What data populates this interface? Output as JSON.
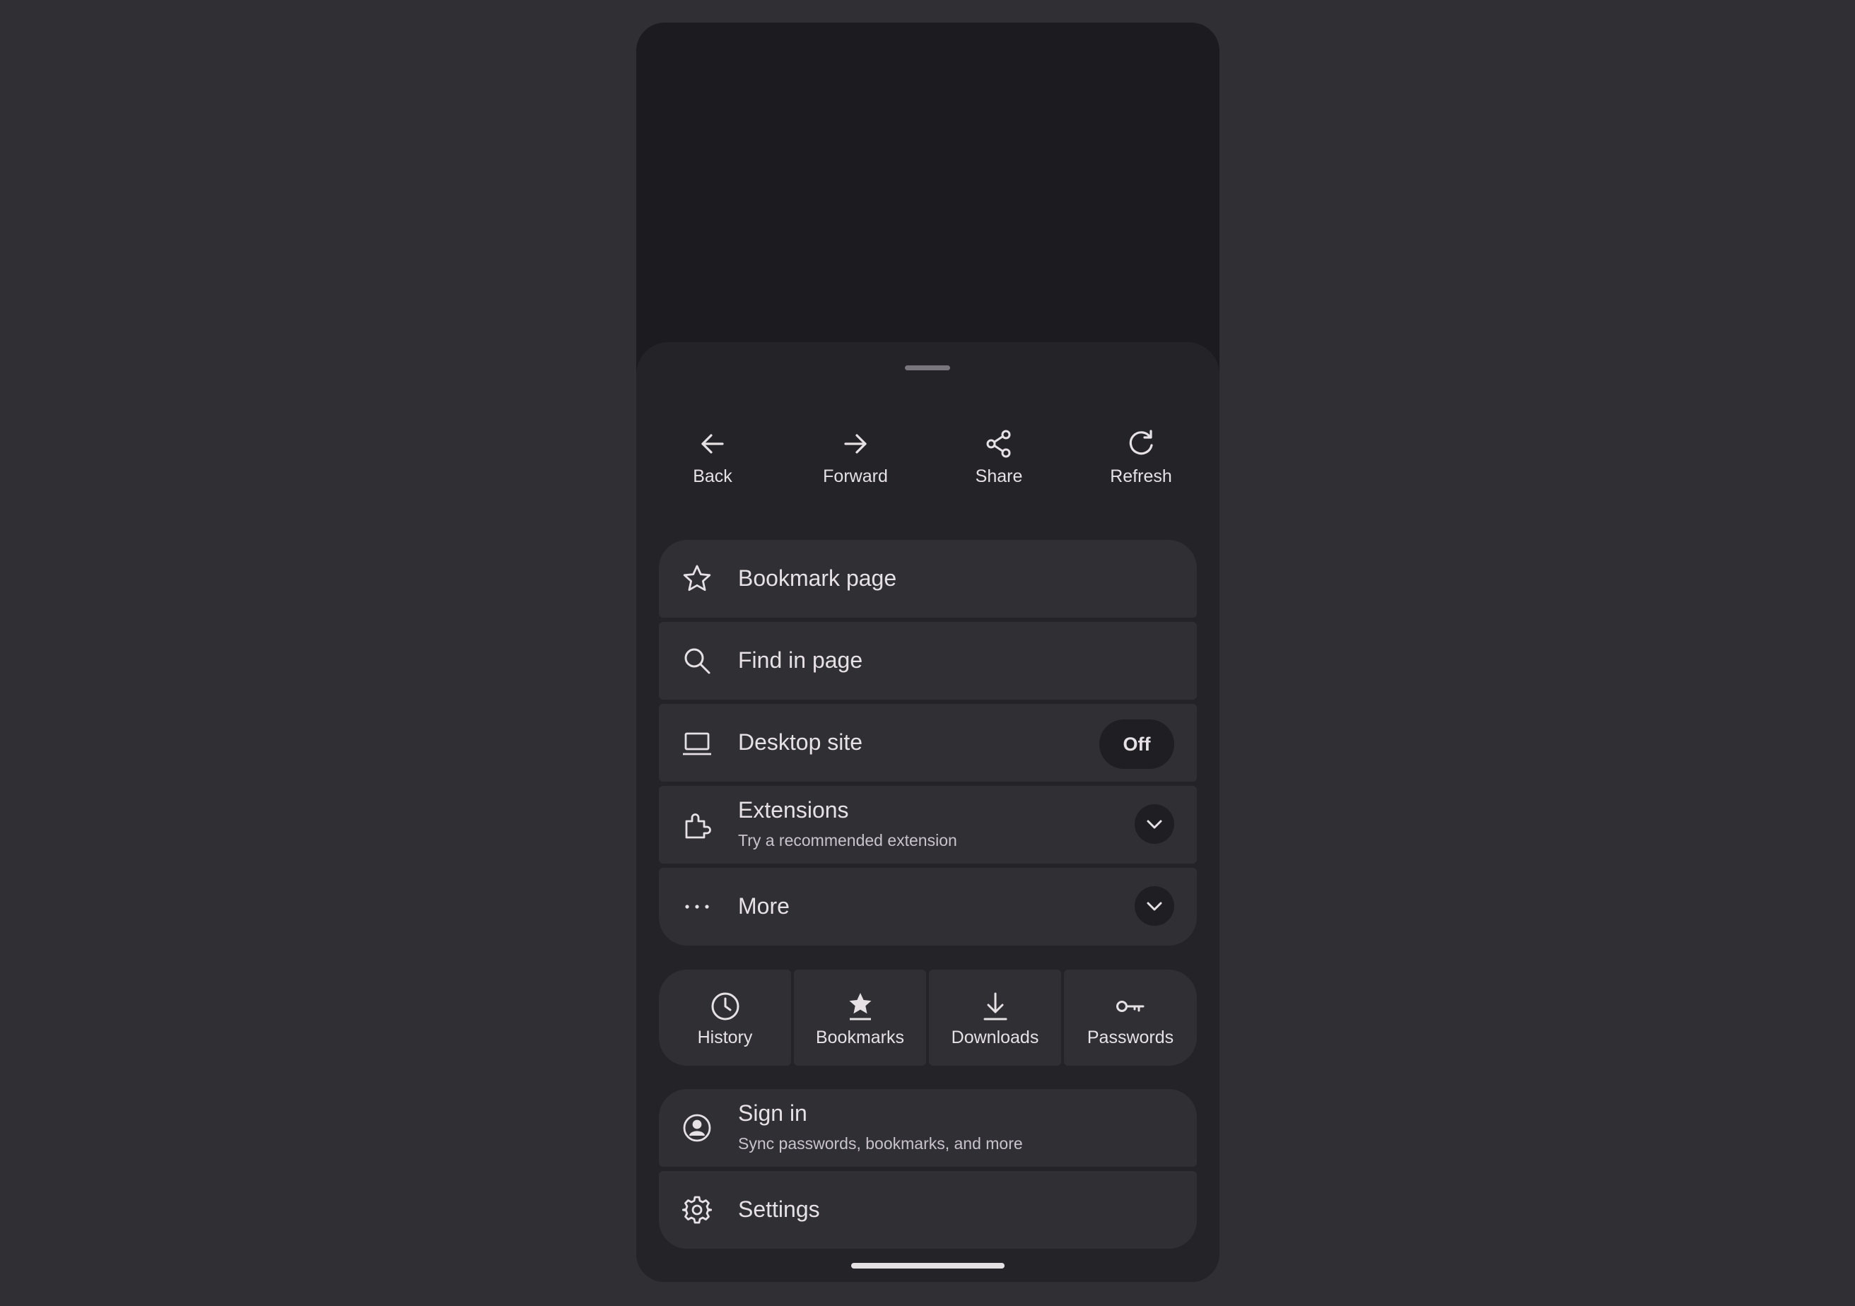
{
  "colors": {
    "backdrop": "#302f33",
    "screen": "#1c1b1f",
    "sheet": "#242328",
    "card": "#302f34",
    "pill": "#1f1e22",
    "text": "#e6e1e5",
    "subtext": "#c9c4cc"
  },
  "toolbar": {
    "back": {
      "label": "Back",
      "icon": "arrow-left-icon"
    },
    "forward": {
      "label": "Forward",
      "icon": "arrow-right-icon"
    },
    "share": {
      "label": "Share",
      "icon": "share-icon"
    },
    "refresh": {
      "label": "Refresh",
      "icon": "refresh-icon"
    }
  },
  "menu": {
    "bookmark_page": {
      "label": "Bookmark page",
      "icon": "star-outline-icon"
    },
    "find_in_page": {
      "label": "Find in page",
      "icon": "search-icon"
    },
    "desktop_site": {
      "label": "Desktop site",
      "icon": "laptop-icon",
      "state": "Off"
    },
    "extensions": {
      "label": "Extensions",
      "subtitle": "Try a recommended extension",
      "icon": "puzzle-icon"
    },
    "more": {
      "label": "More",
      "icon": "more-horizontal-icon"
    }
  },
  "shortcuts": {
    "history": {
      "label": "History",
      "icon": "clock-icon"
    },
    "bookmarks": {
      "label": "Bookmarks",
      "icon": "bookmark-star-icon"
    },
    "downloads": {
      "label": "Downloads",
      "icon": "download-icon"
    },
    "passwords": {
      "label": "Passwords",
      "icon": "key-icon"
    }
  },
  "account": {
    "sign_in": {
      "label": "Sign in",
      "subtitle": "Sync passwords, bookmarks, and more",
      "icon": "account-circle-icon"
    },
    "settings": {
      "label": "Settings",
      "icon": "gear-icon"
    }
  }
}
